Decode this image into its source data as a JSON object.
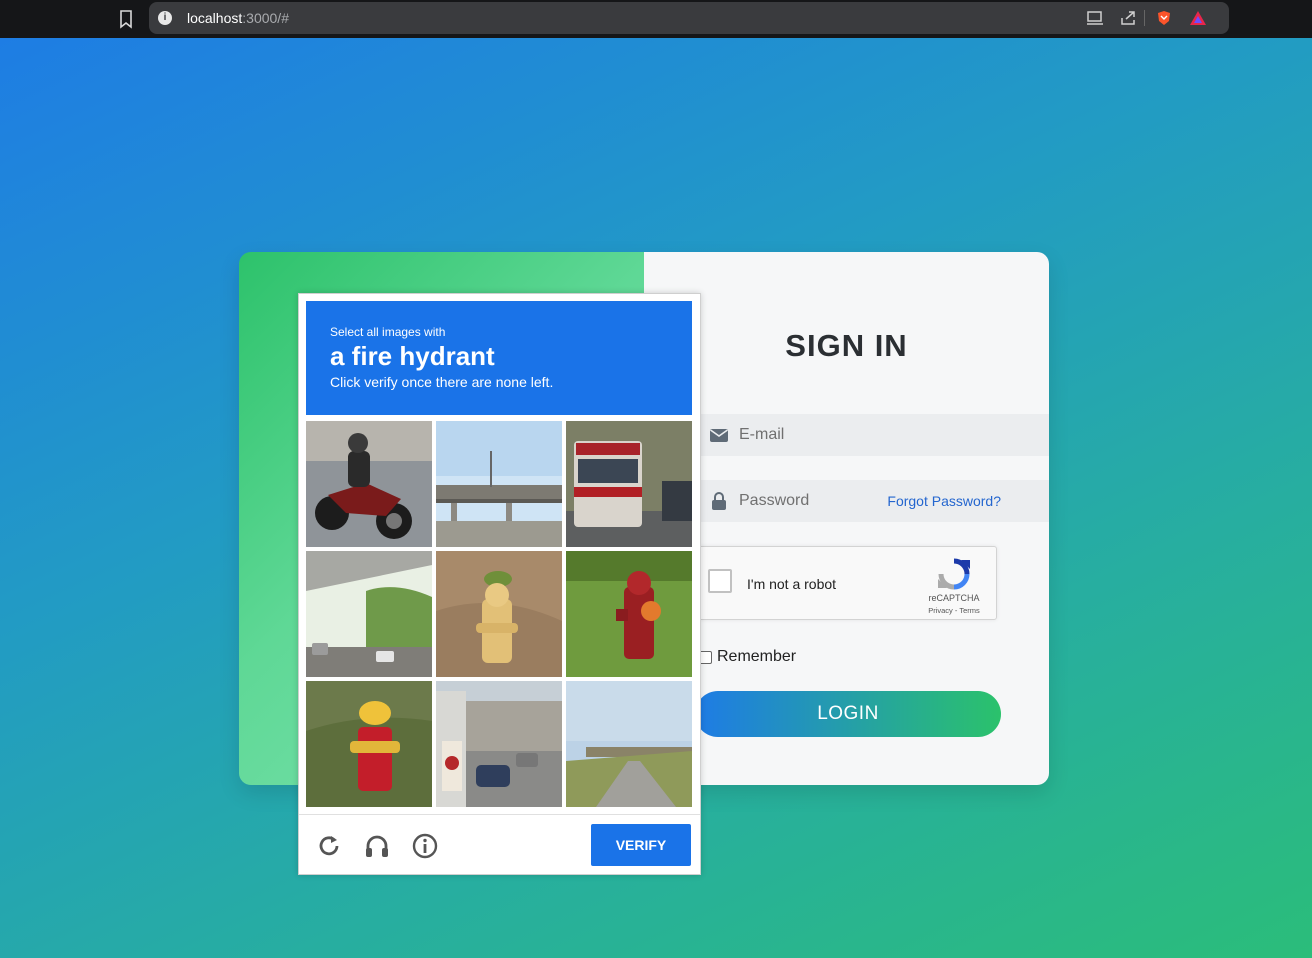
{
  "browser": {
    "url_host": "localhost",
    "url_rest": ":3000/#"
  },
  "login": {
    "title": "SIGN IN",
    "email_placeholder": "E-mail",
    "password_placeholder": "Password",
    "forgot_password": "Forgot Password?",
    "remember_label": "Remember",
    "login_button": "LOGIN"
  },
  "recaptcha": {
    "label": "I'm not a robot",
    "brand": "reCAPTCHA",
    "terms": "Privacy - Terms"
  },
  "challenge": {
    "pre_text": "Select all images with",
    "target": "a fire hydrant",
    "post_text": "Click verify once there are none left.",
    "verify_label": "VERIFY",
    "tiles": [
      {
        "subject": "motorcycle"
      },
      {
        "subject": "overpass"
      },
      {
        "subject": "bus"
      },
      {
        "subject": "highway-trees"
      },
      {
        "subject": "yellow-fire-hydrant"
      },
      {
        "subject": "red-fire-hydrant"
      },
      {
        "subject": "red-yellow-fire-hydrant"
      },
      {
        "subject": "street-cars"
      },
      {
        "subject": "bridge-road"
      }
    ]
  },
  "colors": {
    "accent_blue": "#1a73e8",
    "accent_green": "#2bc26b",
    "link": "#2466cf"
  }
}
